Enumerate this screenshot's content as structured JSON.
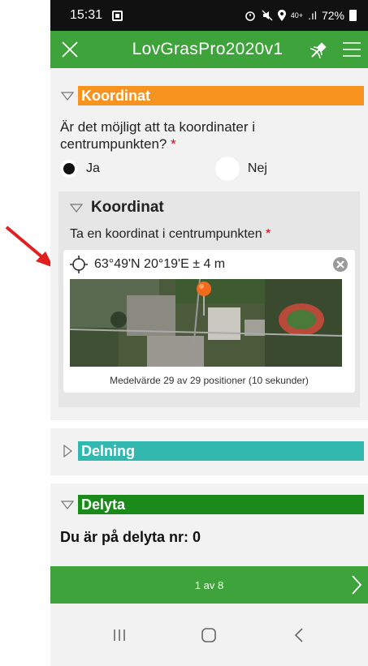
{
  "status": {
    "time": "15:31",
    "right_icons": "40+",
    "battery": "72%",
    "signal": ".ıl"
  },
  "appbar": {
    "title": "LovGrasPro2020v1"
  },
  "sections": {
    "koordinat": {
      "title": "Koordinat"
    },
    "question": {
      "text": "Är det möjligt att ta koordinater i centrumpunkten?",
      "required_mark": "*",
      "options": [
        "Ja",
        "Nej"
      ],
      "selected": "Ja"
    },
    "sub_koordinat": {
      "title": "Koordinat",
      "label": "Ta en koordinat i centrumpunkten",
      "required_mark": "*",
      "location": "63°49'N 20°19'E ± 4 m",
      "average": "Medelvärde 29 av 29 positioner (10 sekunder)"
    },
    "delning": {
      "title": "Delning"
    },
    "delyta": {
      "title": "Delyta",
      "text": "Du är på delyta nr: 0"
    }
  },
  "footer": {
    "page": "1 av 8"
  },
  "colors": {
    "appbar": "#3da33a",
    "koordinat_bar": "#f7931e",
    "delning_bar": "#33b8b0",
    "delyta_bar": "#1a8a1a",
    "arrow": "#e02020"
  }
}
